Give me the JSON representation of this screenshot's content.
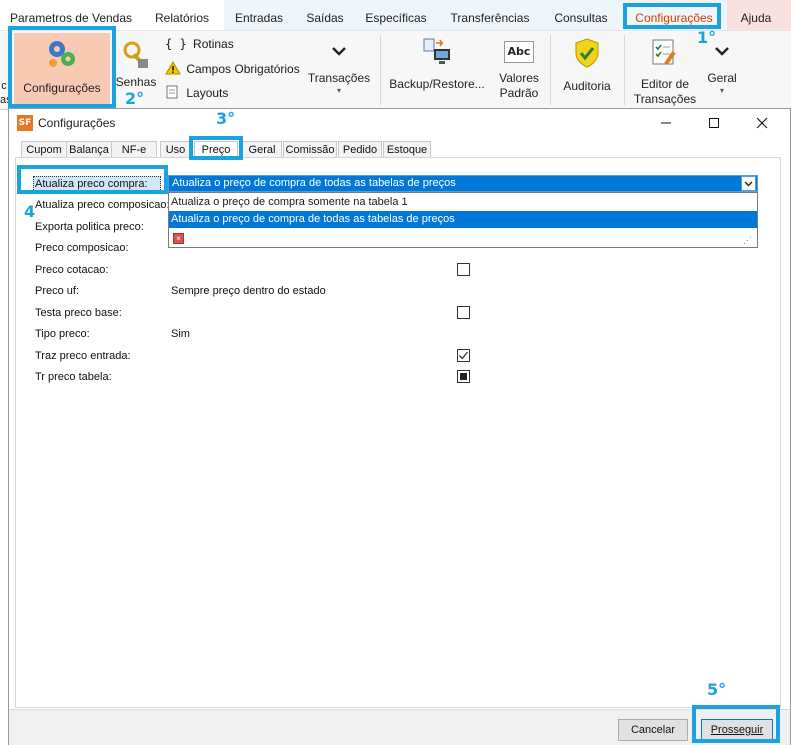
{
  "menu": {
    "tabs": [
      "Parametros de Vendas",
      "Relatórios",
      "Entradas",
      "Saídas",
      "Específicas",
      "Transferências",
      "Consultas",
      "Configurações",
      "Ajuda"
    ]
  },
  "ribbon": {
    "left_cut_label": "c\nas",
    "configuracoes": "Configurações",
    "senhas": "Senhas",
    "rotinas": "Rotinas",
    "rotinas_glyph": "{ }",
    "campos": "Campos Obrigatórios",
    "layouts": "Layouts",
    "transacoes": "Transações",
    "backup": "Backup/Restore...",
    "valores": "Valores\nPadrão",
    "valores_icon_text": "Abc",
    "auditoria": "Auditoria",
    "editor": "Editor de\nTransações",
    "geral": "Geral"
  },
  "steps": {
    "s1": "1°",
    "s2": "2°",
    "s3": "3°",
    "s4": "4",
    "s5": "5°"
  },
  "dialog": {
    "icon_text": "SF",
    "title": "Configurações",
    "tabs": [
      "Cupom",
      "Balança",
      "NF-e",
      "Uso",
      "Preço",
      "Geral",
      "Comissão",
      "Pedido",
      "Estoque"
    ],
    "fields": [
      {
        "label": "Atualiza preco compra:",
        "value": "Atualiza o preço de compra de todas as tabelas de preços"
      },
      {
        "label": "Atualiza preco composicao:",
        "value": ""
      },
      {
        "label": "Exporta politica preco:",
        "value": ""
      },
      {
        "label": "Preco composicao:",
        "value": ""
      },
      {
        "label": "Preco cotacao:",
        "value": ""
      },
      {
        "label": "Preco uf:",
        "value": "Sempre preço dentro do estado"
      },
      {
        "label": "Testa preco base:",
        "value": ""
      },
      {
        "label": "Tipo preco:",
        "value": "Sim"
      },
      {
        "label": "Traz preco entrada:",
        "value": ""
      },
      {
        "label": "Tr preco tabela:",
        "value": ""
      }
    ],
    "checkboxes": {
      "preco_cotacao": "unchecked",
      "testa_preco_base": "unchecked",
      "traz_preco_entrada": "checked",
      "tr_preco_tabela": "indeterminate"
    },
    "dropdown_options": [
      "Atualiza o preço de compra somente na tabela 1",
      "Atualiza o preço de compra de todas as tabelas de preços"
    ],
    "cancel": "Cancelar",
    "proceed": "Prosseguir"
  },
  "colors": {
    "accent": "#1aa3e0",
    "selection": "#0078d7",
    "config_tab_bg": "#f8c9b3",
    "ajuda_bg": "#fbe0e0",
    "tabs_bg": "#f2f7fb"
  }
}
